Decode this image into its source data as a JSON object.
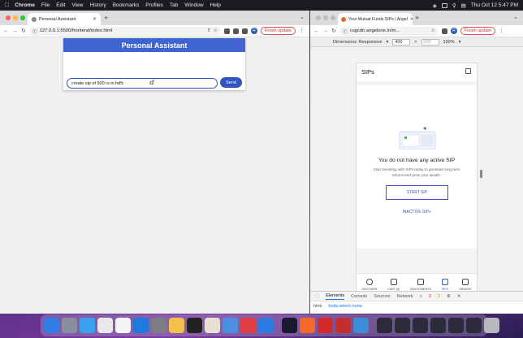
{
  "menubar": {
    "app": "Chrome",
    "items": [
      "File",
      "Edit",
      "View",
      "History",
      "Bookmarks",
      "Profiles",
      "Tab",
      "Window",
      "Help"
    ],
    "datetime": "Thu Oct 12  5:47 PM"
  },
  "left_window": {
    "tab_title": "Personal Assistant",
    "url": "127.0.0.1:5500/frontend/index.html",
    "finish_update": "Finish update",
    "avatar_letter": "R",
    "app": {
      "header": "Personal Assistant",
      "input_value": "create sip of 500 rs in hdfc",
      "send_label": "Send"
    }
  },
  "right_window": {
    "tab_title": "Your Mutual Funds SIPs | Angel",
    "url": "cugcdn.angelone.in/m...",
    "finish_update": "Finish update",
    "avatar_letter": "R",
    "devtools_toolbar": {
      "dimensions_label": "Dimensions: Responsive",
      "width": "400",
      "height": "550",
      "zoom": "100%"
    },
    "sip_page": {
      "title": "SIPs",
      "empty_title": "You do not have any active SIP",
      "empty_subtitle": "Start investing with SIPs today to generate long term returns and grow your wealth.",
      "start_sip": "START SIP",
      "inactive_sips": "INACTIVE SIPs",
      "nav": [
        {
          "label": "DISCOVER",
          "icon": "compass-icon"
        },
        {
          "label": "CART (0)",
          "icon": "cart-icon"
        },
        {
          "label": "INVESTMENTS",
          "icon": "chart-icon"
        },
        {
          "label": "SIPS",
          "icon": "sip-icon"
        },
        {
          "label": "ORDERS",
          "icon": "orders-icon"
        }
      ]
    },
    "devtools_panel": {
      "tabs": [
        "Elements",
        "Console",
        "Sources",
        "Network"
      ],
      "error_count": "3",
      "warning_count": "1",
      "breadcrumb_html": "html",
      "breadcrumb_selected": "body.select-none"
    }
  },
  "colors": {
    "assistant_blue": "#3f63d0",
    "angel_blue": "#3558c5",
    "finish_update_red": "#d9534f"
  }
}
